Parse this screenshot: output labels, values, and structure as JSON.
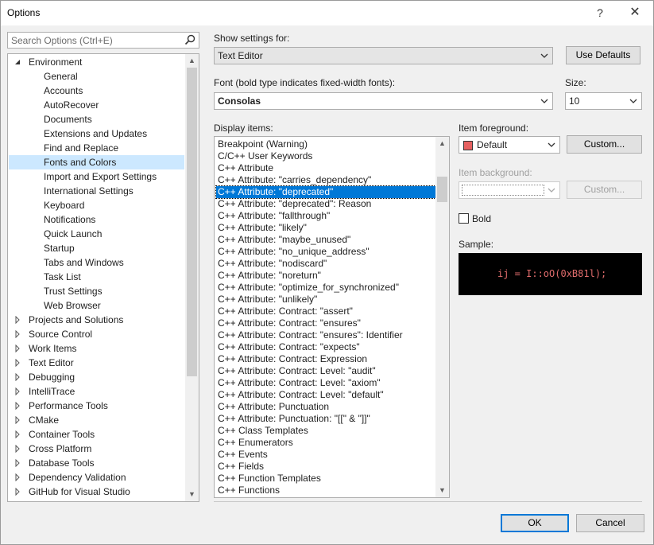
{
  "window": {
    "title": "Options",
    "help_glyph": "?",
    "close_glyph": "✕"
  },
  "search": {
    "placeholder": "Search Options (Ctrl+E)"
  },
  "tree": {
    "items": [
      {
        "label": "Environment",
        "level": 0,
        "expanded": true
      },
      {
        "label": "General",
        "level": 1
      },
      {
        "label": "Accounts",
        "level": 1
      },
      {
        "label": "AutoRecover",
        "level": 1
      },
      {
        "label": "Documents",
        "level": 1
      },
      {
        "label": "Extensions and Updates",
        "level": 1
      },
      {
        "label": "Find and Replace",
        "level": 1
      },
      {
        "label": "Fonts and Colors",
        "level": 1,
        "selected": true
      },
      {
        "label": "Import and Export Settings",
        "level": 1
      },
      {
        "label": "International Settings",
        "level": 1
      },
      {
        "label": "Keyboard",
        "level": 1
      },
      {
        "label": "Notifications",
        "level": 1
      },
      {
        "label": "Quick Launch",
        "level": 1
      },
      {
        "label": "Startup",
        "level": 1
      },
      {
        "label": "Tabs and Windows",
        "level": 1
      },
      {
        "label": "Task List",
        "level": 1
      },
      {
        "label": "Trust Settings",
        "level": 1
      },
      {
        "label": "Web Browser",
        "level": 1
      },
      {
        "label": "Projects and Solutions",
        "level": 0,
        "expanded": false
      },
      {
        "label": "Source Control",
        "level": 0,
        "expanded": false
      },
      {
        "label": "Work Items",
        "level": 0,
        "expanded": false
      },
      {
        "label": "Text Editor",
        "level": 0,
        "expanded": false
      },
      {
        "label": "Debugging",
        "level": 0,
        "expanded": false
      },
      {
        "label": "IntelliTrace",
        "level": 0,
        "expanded": false
      },
      {
        "label": "Performance Tools",
        "level": 0,
        "expanded": false
      },
      {
        "label": "CMake",
        "level": 0,
        "expanded": false
      },
      {
        "label": "Container Tools",
        "level": 0,
        "expanded": false
      },
      {
        "label": "Cross Platform",
        "level": 0,
        "expanded": false
      },
      {
        "label": "Database Tools",
        "level": 0,
        "expanded": false
      },
      {
        "label": "Dependency Validation",
        "level": 0,
        "expanded": false
      },
      {
        "label": "GitHub for Visual Studio",
        "level": 0,
        "expanded": false
      }
    ]
  },
  "show_settings": {
    "label": "Show settings for:",
    "value": "Text Editor",
    "use_defaults": "Use Defaults"
  },
  "font": {
    "label": "Font (bold type indicates fixed-width fonts):",
    "value": "Consolas"
  },
  "size": {
    "label": "Size:",
    "value": "10"
  },
  "display_items": {
    "label": "Display items:",
    "items": [
      "Breakpoint (Warning)",
      "C/C++ User Keywords",
      "C++ Attribute",
      "C++ Attribute: \"carries_dependency\"",
      "C++ Attribute: \"deprecated\"",
      "C++ Attribute: \"deprecated\": Reason",
      "C++ Attribute: \"fallthrough\"",
      "C++ Attribute: \"likely\"",
      "C++ Attribute: \"maybe_unused\"",
      "C++ Attribute: \"no_unique_address\"",
      "C++ Attribute: \"nodiscard\"",
      "C++ Attribute: \"noreturn\"",
      "C++ Attribute: \"optimize_for_synchronized\"",
      "C++ Attribute: \"unlikely\"",
      "C++ Attribute: Contract: \"assert\"",
      "C++ Attribute: Contract: \"ensures\"",
      "C++ Attribute: Contract: \"ensures\": Identifier",
      "C++ Attribute: Contract: \"expects\"",
      "C++ Attribute: Contract: Expression",
      "C++ Attribute: Contract: Level: \"audit\"",
      "C++ Attribute: Contract: Level: \"axiom\"",
      "C++ Attribute: Contract: Level: \"default\"",
      "C++ Attribute: Punctuation",
      "C++ Attribute: Punctuation: \"[[\" & \"]]\"",
      "C++ Class Templates",
      "C++ Enumerators",
      "C++ Events",
      "C++ Fields",
      "C++ Function Templates",
      "C++ Functions"
    ],
    "selected_index": 4
  },
  "item_foreground": {
    "label": "Item foreground:",
    "value": "Default",
    "custom": "Custom...",
    "swatch_color": "#e66060"
  },
  "item_background": {
    "label": "Item background:",
    "value": "",
    "custom": "Custom..."
  },
  "bold": {
    "label": "Bold",
    "checked": false
  },
  "sample": {
    "label": "Sample:",
    "text": "ij = I::oO(0xB81l);",
    "color": "#e06c6c"
  },
  "footer": {
    "ok": "OK",
    "cancel": "Cancel"
  }
}
